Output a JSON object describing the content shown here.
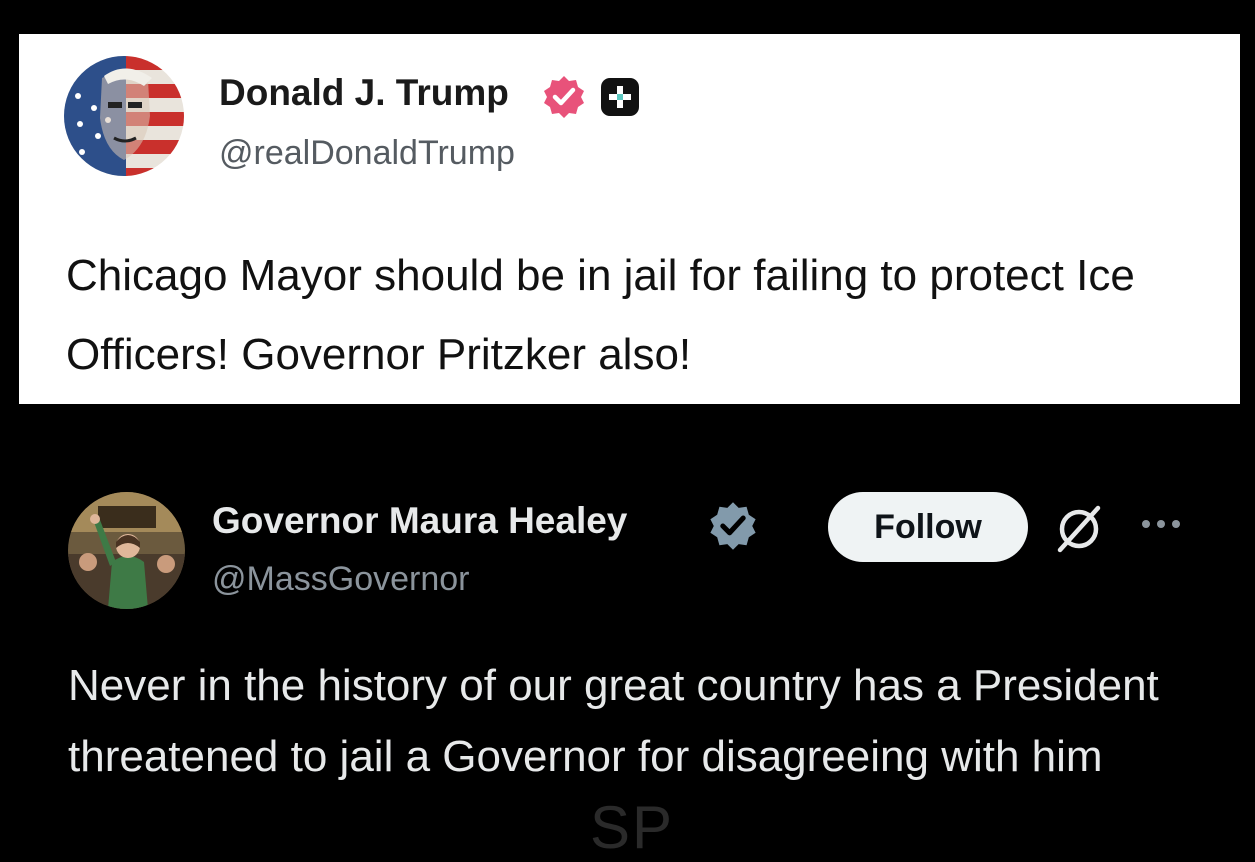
{
  "top_post": {
    "display_name": "Donald J. Trump",
    "handle": "@realDonaldTrump",
    "text": "Chicago Mayor should be in jail for failing to protect Ice Officers! Governor Pritzker also!",
    "verified_badge": "verified-badge-icon",
    "extra_badge": "plus-badge-icon",
    "badge_color": "#e8527a"
  },
  "bottom_post": {
    "display_name": "Governor Maura Healey",
    "handle": "@MassGovernor",
    "follow_label": "Follow",
    "text": "Never in the history of our great country has a President threatened to jail a Governor for disagreeing with him",
    "verified_badge": "verified-badge-icon",
    "badge_color": "#829aab",
    "grok_icon": "grok-icon",
    "more_icon": "more-options-icon"
  },
  "watermark": {
    "text": "SP"
  }
}
